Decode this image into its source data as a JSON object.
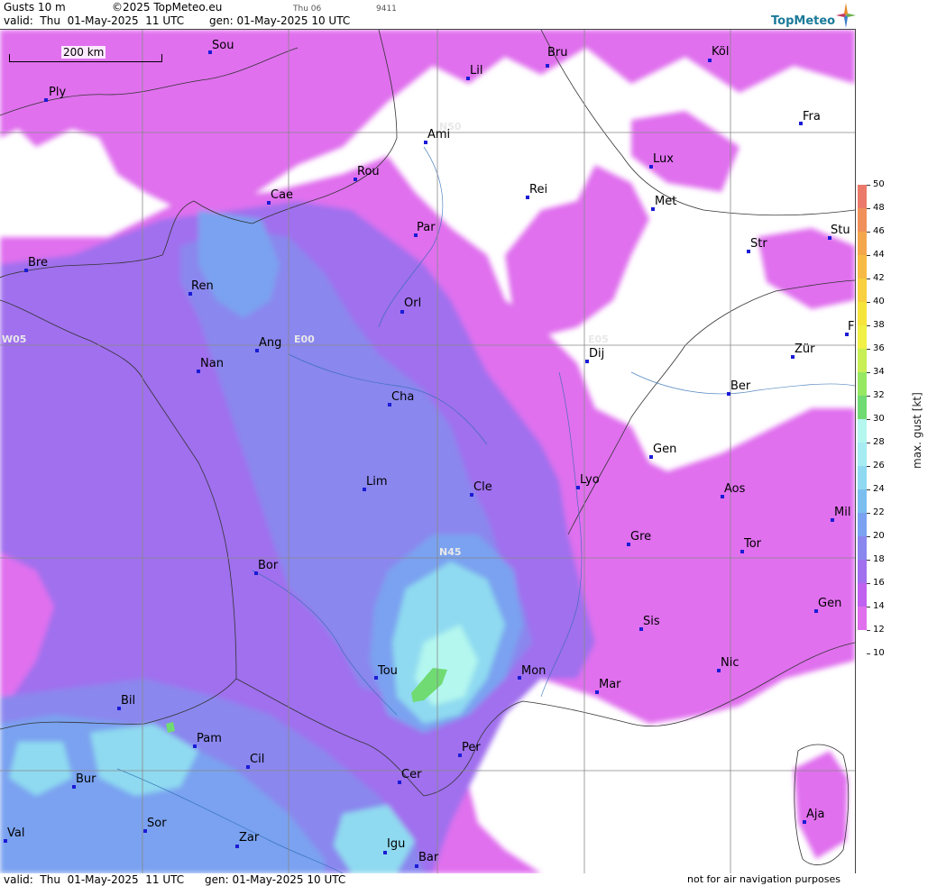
{
  "header": {
    "product": "Gusts 10 m",
    "copyright": "©2025 TopMeteo.eu",
    "day_label": "Thu 06",
    "small_code": "9411",
    "valid": "valid:  Thu  01-May-2025  11 UTC",
    "generated": "gen: 01-May-2025 10 UTC"
  },
  "logo": {
    "text": "TopMeteo",
    "icon": "compass-star-icon"
  },
  "scale_bar": {
    "label": "200 km"
  },
  "grid_labels": [
    "N50",
    "N45",
    "W05",
    "E00",
    "E05"
  ],
  "cities": [
    {
      "key": "sou",
      "name": "Sou"
    },
    {
      "key": "ply",
      "name": "Ply"
    },
    {
      "key": "lil",
      "name": "Lil"
    },
    {
      "key": "bru",
      "name": "Bru"
    },
    {
      "key": "kol",
      "name": "Köl"
    },
    {
      "key": "ami",
      "name": "Ami"
    },
    {
      "key": "fra",
      "name": "Fra"
    },
    {
      "key": "rou",
      "name": "Rou"
    },
    {
      "key": "lux",
      "name": "Lux"
    },
    {
      "key": "cae",
      "name": "Cae"
    },
    {
      "key": "rei",
      "name": "Rei"
    },
    {
      "key": "met",
      "name": "Met"
    },
    {
      "key": "par",
      "name": "Par"
    },
    {
      "key": "stu",
      "name": "Stu"
    },
    {
      "key": "bre",
      "name": "Bre"
    },
    {
      "key": "str",
      "name": "Str"
    },
    {
      "key": "ren",
      "name": "Ren"
    },
    {
      "key": "orl",
      "name": "Orl"
    },
    {
      "key": "ang",
      "name": "Ang"
    },
    {
      "key": "dij",
      "name": "Dij"
    },
    {
      "key": "zur",
      "name": "Zür"
    },
    {
      "key": "nan",
      "name": "Nan"
    },
    {
      "key": "ber",
      "name": "Ber"
    },
    {
      "key": "cha",
      "name": "Cha"
    },
    {
      "key": "gen1",
      "name": "Gen"
    },
    {
      "key": "lim",
      "name": "Lim"
    },
    {
      "key": "cle",
      "name": "Cle"
    },
    {
      "key": "lyo",
      "name": "Lyo"
    },
    {
      "key": "aos",
      "name": "Aos"
    },
    {
      "key": "mil",
      "name": "Mil"
    },
    {
      "key": "gre",
      "name": "Gre"
    },
    {
      "key": "tor",
      "name": "Tor"
    },
    {
      "key": "bor",
      "name": "Bor"
    },
    {
      "key": "gen2",
      "name": "Gen"
    },
    {
      "key": "sis",
      "name": "Sis"
    },
    {
      "key": "tou",
      "name": "Tou"
    },
    {
      "key": "mon",
      "name": "Mon"
    },
    {
      "key": "nic",
      "name": "Nic"
    },
    {
      "key": "mar",
      "name": "Mar"
    },
    {
      "key": "bil",
      "name": "Bil"
    },
    {
      "key": "pam",
      "name": "Pam"
    },
    {
      "key": "per",
      "name": "Per"
    },
    {
      "key": "cil",
      "name": "Cil"
    },
    {
      "key": "bur",
      "name": "Bur"
    },
    {
      "key": "cer",
      "name": "Cer"
    },
    {
      "key": "sor",
      "name": "Sor"
    },
    {
      "key": "aja",
      "name": "Aja"
    },
    {
      "key": "val",
      "name": "Val"
    },
    {
      "key": "zar",
      "name": "Zar"
    },
    {
      "key": "igu",
      "name": "Igu"
    },
    {
      "key": "bar",
      "name": "Bar"
    },
    {
      "key": "f",
      "name": "F"
    }
  ],
  "legend": {
    "title": "max. gust [kt]",
    "labels": [
      "50",
      "48",
      "46",
      "44",
      "42",
      "40",
      "38",
      "36",
      "34",
      "32",
      "30",
      "28",
      "26",
      "24",
      "22",
      "20",
      "18",
      "16",
      "14",
      "12",
      "10"
    ],
    "colors": [
      "#ec7a6b",
      "#f0905a",
      "#f4a64c",
      "#f7bb45",
      "#f8d040",
      "#f6e43c",
      "#f0f046",
      "#c8ef55",
      "#96e863",
      "#6fdb72",
      "#b4f7ef",
      "#a6ecf3",
      "#8fdaf0",
      "#7bbef0",
      "#7aa2f0",
      "#8a87ee",
      "#a070ee",
      "#c062ef",
      "#e070ee",
      "#ffffff"
    ]
  },
  "footer": {
    "left": "valid:  Thu  01-May-2025  11 UTC      gen: 01-May-2025 10 UTC",
    "right": "not for air navigation purposes"
  }
}
